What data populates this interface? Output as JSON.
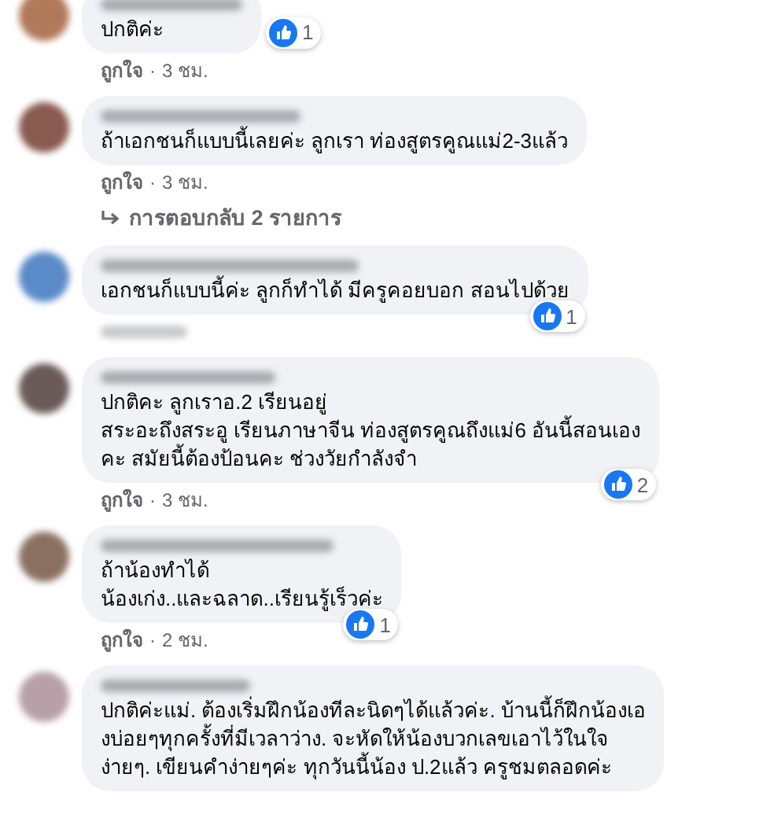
{
  "comments": [
    {
      "color": "#b07a5a",
      "text": "ปกติค่ะ",
      "reactions": "1",
      "like_label": "ถูกใจ",
      "separator": "·",
      "time": "3 ชม."
    },
    {
      "color": "#8a5a50",
      "text": "ถ้าเอกชนก็แบบนี้เลยค่ะ ลูกเรา ท่องสูตรคูณแม่2-3แล้ว",
      "like_label": "ถูกใจ",
      "separator": "·",
      "time": "3 ชม.",
      "replies": "การตอบกลับ 2 รายการ"
    },
    {
      "color": "#5a8ac8",
      "text": "เอกชนก็แบบนี้ค่ะ ลูกก็ทำได้ มีครูคอยบอก สอนไปด้วย",
      "reactions": "1"
    },
    {
      "color": "#6a5a58",
      "text": "ปกติคะ ลูกเราอ.2 เรียนอยู่\nสระอะถึงสระอู เรียนภาษาจีน ท่องสูตรคูณถึงแม่6 อันนี้สอนเอง\nคะ สมัยนี้ต้องป้อนคะ ช่วงวัยกำลังจำ",
      "reactions": "2",
      "like_label": "ถูกใจ",
      "separator": "·",
      "time": "3 ชม."
    },
    {
      "color": "#8a7060",
      "text": "ถ้าน้องทำได้\nน้องเก่ง..และฉลาด..เรียนรู้เร็วค่ะ",
      "reactions": "1",
      "like_label": "ถูกใจ",
      "separator": "·",
      "time": "2 ชม."
    },
    {
      "color": "#b8a0a8",
      "text": "ปกติค่ะแม่. ต้องเริ่มฝึกน้องทีละนิดๆได้แล้วค่ะ. บ้านนี้ก็ฝึกน้องเอ\nงบ่อยๆทุกครั้งที่มีเวลาว่าง. จะหัดให้น้องบวกเลขเอาไว้ในใจ\nง่ายๆ. เขียนคำง่ายๆค่ะ ทุกวันนี้น้อง ป.2แล้ว ครูชมตลอดค่ะ"
    }
  ]
}
